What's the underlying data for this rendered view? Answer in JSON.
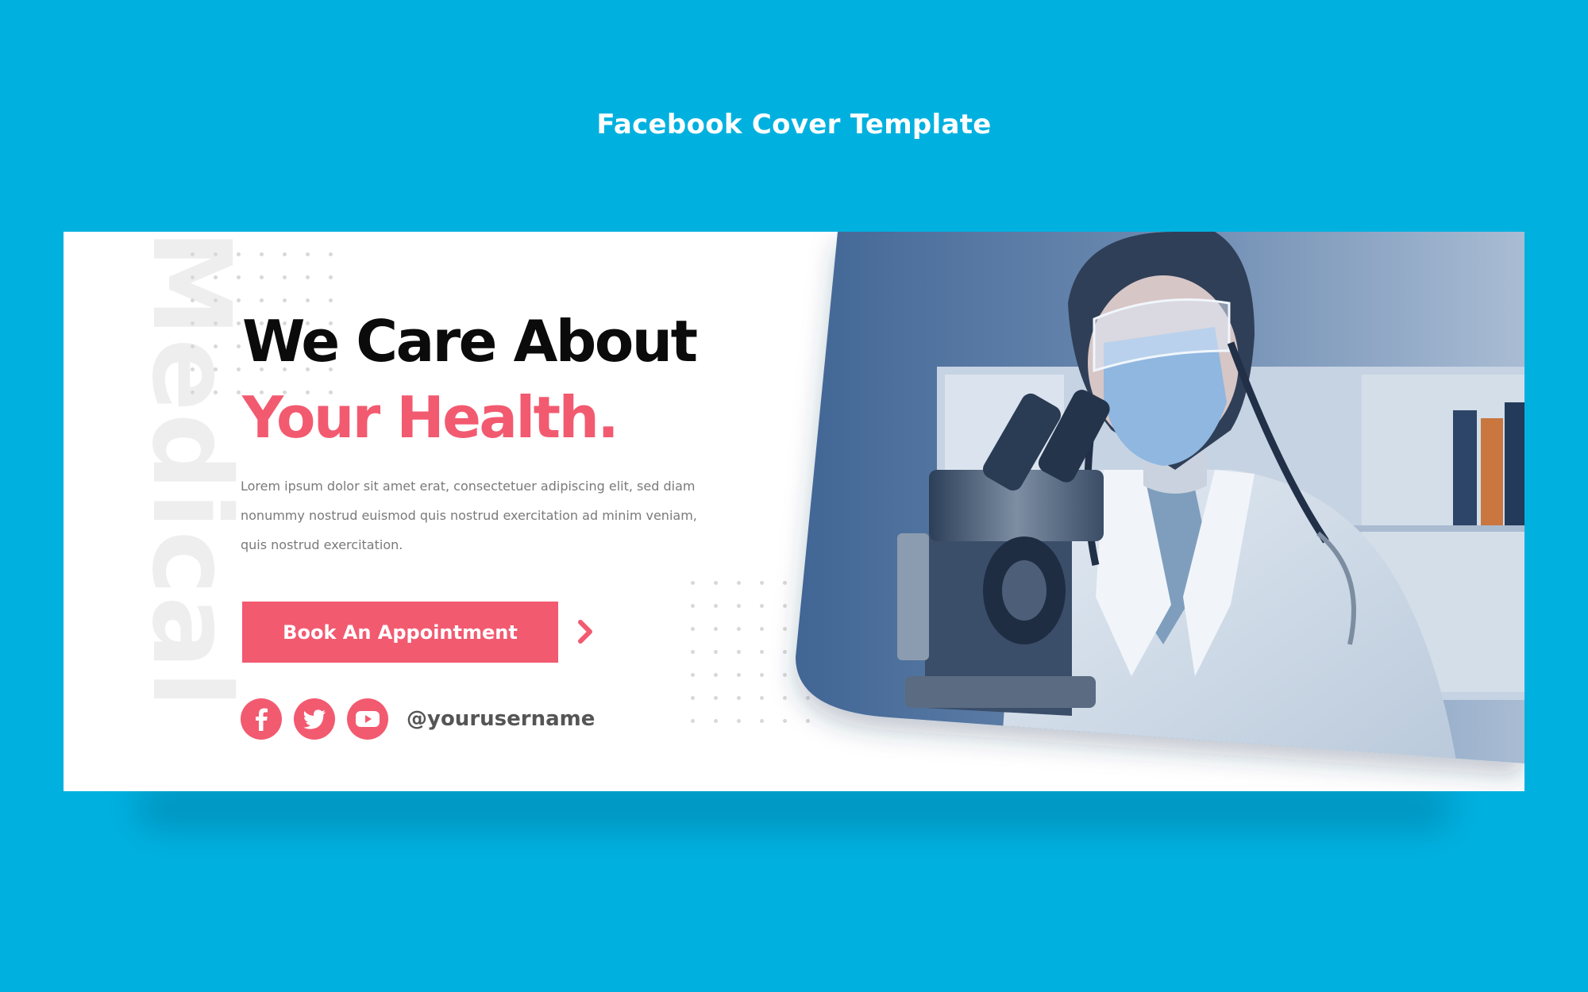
{
  "page": {
    "title": "Facebook Cover Template"
  },
  "cover": {
    "vertical_word": "Medical",
    "heading_line_1": "We Care About",
    "heading_line_2": "Your Health.",
    "body_lines": [
      "Lorem ipsum dolor sit amet erat, consectetuer adipiscing elit, sed diam",
      "nonummy nostrud euismod quis nostrud exercitation ad minim veniam,",
      "quis nostrud exercitation."
    ],
    "cta_label": "Book An Appointment",
    "cta_icon": "chevron-right-icon",
    "social_icons": [
      "facebook-icon",
      "twitter-icon",
      "youtube-icon"
    ],
    "username": "@yourusername",
    "photo_subject": "doctor-at-microscope-photo"
  },
  "colors": {
    "background": "#00b1e0",
    "accent": "#f25a70",
    "heading": "#0b0b0b",
    "body_text": "#7a7a7a",
    "watermark": "#eeeeee"
  }
}
